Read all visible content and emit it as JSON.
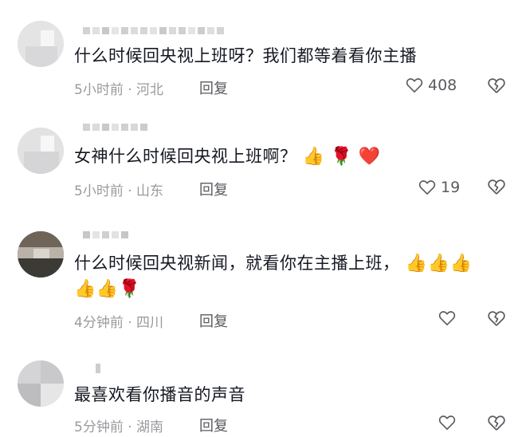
{
  "comments": [
    {
      "text": "什么时候回央视上班呀？我们都等着看你主播",
      "time": "5小时前",
      "location": "河北",
      "reply_label": "回复",
      "likes": "408"
    },
    {
      "text": "女神什么时候回央视上班啊？",
      "emojis": [
        "👍",
        "🌹",
        "❤️"
      ],
      "time": "5小时前",
      "location": "山东",
      "reply_label": "回复",
      "likes": "19"
    },
    {
      "text": "什么时候回央视新闻，就看你在主播上班，",
      "emojis_line1": [
        "👍",
        "👍",
        "👍"
      ],
      "emojis_line2": [
        "👍",
        "👍",
        "🌹"
      ],
      "time": "4分钟前",
      "location": "四川",
      "reply_label": "回复",
      "likes": ""
    },
    {
      "text": "最喜欢看你播音的声音",
      "time": "5分钟前",
      "location": "湖南",
      "reply_label": "回复",
      "likes": ""
    }
  ],
  "meta_separator": " · ",
  "icons": {
    "like": "heart-outline-icon",
    "dislike": "broken-heart-icon"
  },
  "colors": {
    "text": "#161823",
    "meta": "#9a9a9f",
    "action": "#5a5a60"
  }
}
